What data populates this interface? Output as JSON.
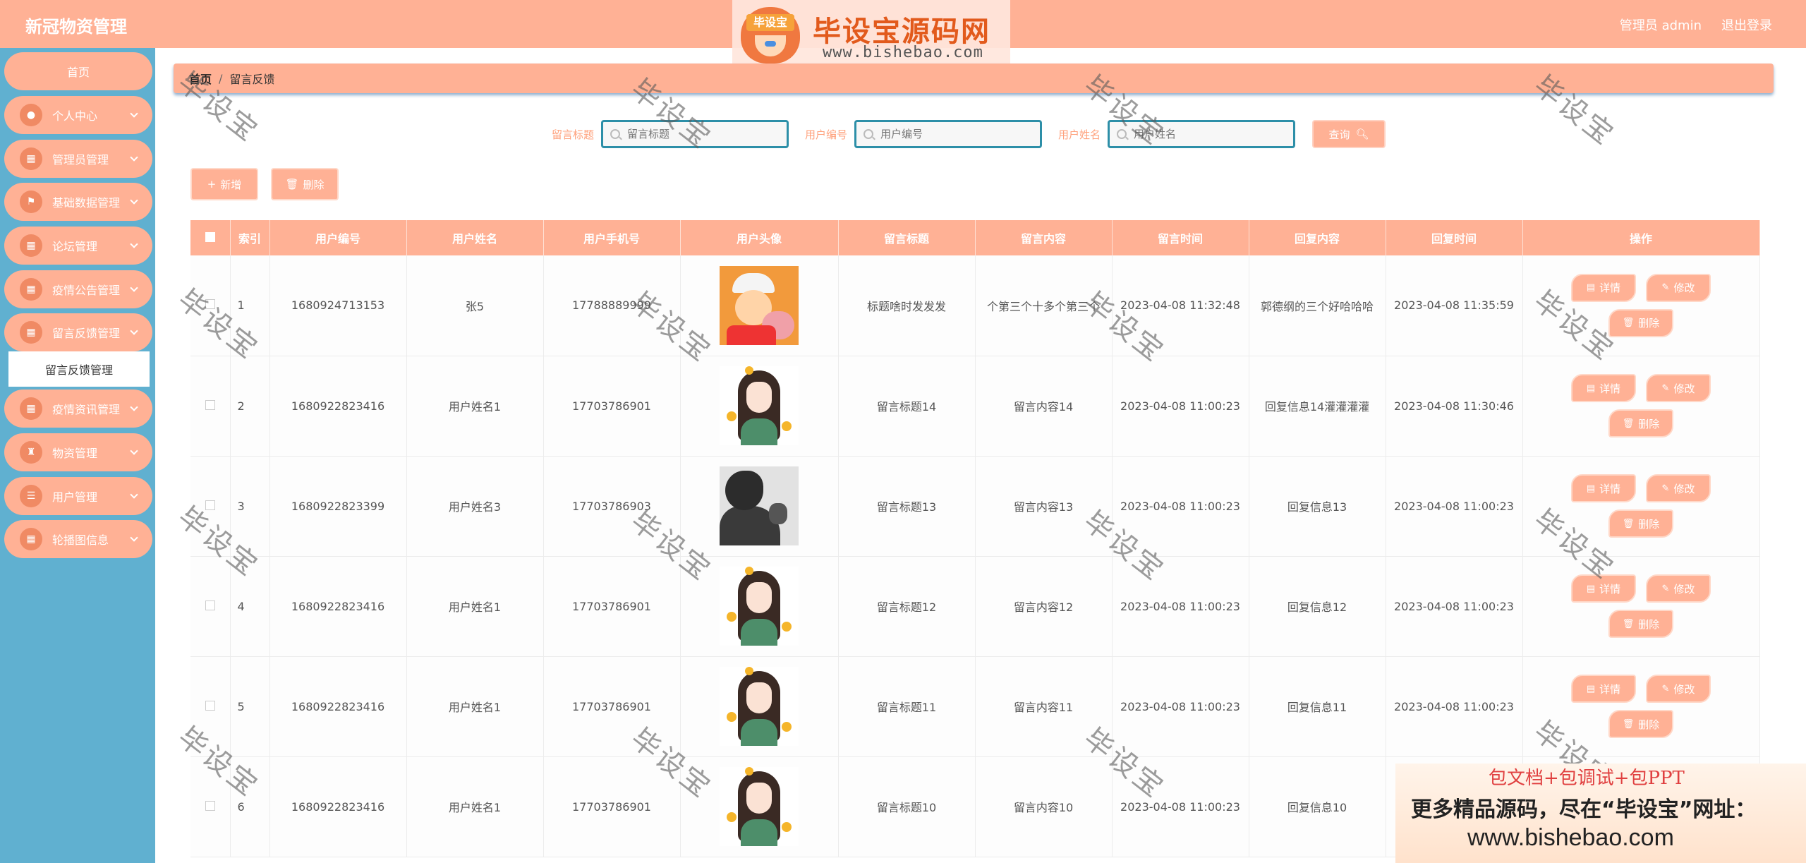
{
  "header": {
    "app_title": "新冠物资管理",
    "user_label": "管理员 admin",
    "logout_label": "退出登录"
  },
  "logo_watermark": {
    "badge_text": "毕设宝",
    "site_name": "毕设宝源码网",
    "url": "www.bishebao.com"
  },
  "sidebar": {
    "items": [
      {
        "label": "首页",
        "icon": "home-icon"
      },
      {
        "label": "个人中心",
        "icon": "person-icon"
      },
      {
        "label": "管理员管理",
        "icon": "grid-icon"
      },
      {
        "label": "基础数据管理",
        "icon": "flag-icon"
      },
      {
        "label": "论坛管理",
        "icon": "grid-icon"
      },
      {
        "label": "疫情公告管理",
        "icon": "grid-icon"
      },
      {
        "label": "留言反馈管理",
        "icon": "grid-icon"
      },
      {
        "label": "疫情资讯管理",
        "icon": "grid-icon"
      },
      {
        "label": "物资管理",
        "icon": "trophy-icon"
      },
      {
        "label": "用户管理",
        "icon": "list-icon"
      },
      {
        "label": "轮播图信息",
        "icon": "grid-icon"
      }
    ],
    "active_submenu": "留言反馈管理"
  },
  "breadcrumb": {
    "home": "首页",
    "separator": "/",
    "current": "留言反馈"
  },
  "search": {
    "fields": [
      {
        "label": "留言标题",
        "placeholder": "留言标题"
      },
      {
        "label": "用户编号",
        "placeholder": "用户编号"
      },
      {
        "label": "用户姓名",
        "placeholder": "用户姓名"
      }
    ],
    "query_label": "查询"
  },
  "actions": {
    "add_label": "新增",
    "delete_label": "删除"
  },
  "table": {
    "columns": [
      "索引",
      "用户编号",
      "用户姓名",
      "用户手机号",
      "用户头像",
      "留言标题",
      "留言内容",
      "留言时间",
      "回复内容",
      "回复时间",
      "操作"
    ],
    "rows": [
      {
        "idx": "1",
        "user_no": "1680924713153",
        "name": "张5",
        "phone": "17788889999",
        "avatar": "cartoon",
        "title": "标题啥时发发发",
        "content": "个第三个十多个第三个",
        "time": "2023-04-08 11:32:48",
        "reply": "郭德纲的三个好哈哈哈",
        "reply_time": "2023-04-08 11:35:59"
      },
      {
        "idx": "2",
        "user_no": "1680922823416",
        "name": "用户姓名1",
        "phone": "17703786901",
        "avatar": "girl",
        "title": "留言标题14",
        "content": "留言内容14",
        "time": "2023-04-08 11:00:23",
        "reply": "回复信息14灌灌灌灌",
        "reply_time": "2023-04-08 11:30:46"
      },
      {
        "idx": "3",
        "user_no": "1680922823399",
        "name": "用户姓名3",
        "phone": "17703786903",
        "avatar": "silhouette",
        "title": "留言标题13",
        "content": "留言内容13",
        "time": "2023-04-08 11:00:23",
        "reply": "回复信息13",
        "reply_time": "2023-04-08 11:00:23"
      },
      {
        "idx": "4",
        "user_no": "1680922823416",
        "name": "用户姓名1",
        "phone": "17703786901",
        "avatar": "girl",
        "title": "留言标题12",
        "content": "留言内容12",
        "time": "2023-04-08 11:00:23",
        "reply": "回复信息12",
        "reply_time": "2023-04-08 11:00:23"
      },
      {
        "idx": "5",
        "user_no": "1680922823416",
        "name": "用户姓名1",
        "phone": "17703786901",
        "avatar": "girl",
        "title": "留言标题11",
        "content": "留言内容11",
        "time": "2023-04-08 11:00:23",
        "reply": "回复信息11",
        "reply_time": "2023-04-08 11:00:23"
      },
      {
        "idx": "6",
        "user_no": "1680922823416",
        "name": "用户姓名1",
        "phone": "17703786901",
        "avatar": "girl",
        "title": "留言标题10",
        "content": "留言内容10",
        "time": "2023-04-08 11:00:23",
        "reply": "回复信息10",
        "reply_time": ""
      }
    ],
    "row_actions": {
      "detail": "详情",
      "edit": "修改",
      "delete": "删除"
    }
  },
  "watermark_text": "毕设宝",
  "promo": {
    "line1": "包文档+包调试+包PPT",
    "line2": "更多精品源码，尽在“毕设宝”网址：",
    "url": "www.bishebao.com"
  },
  "colors": {
    "accent": "#ffb195",
    "sidebar_bg": "#60b0d0",
    "input_border": "#2d8fa8"
  }
}
